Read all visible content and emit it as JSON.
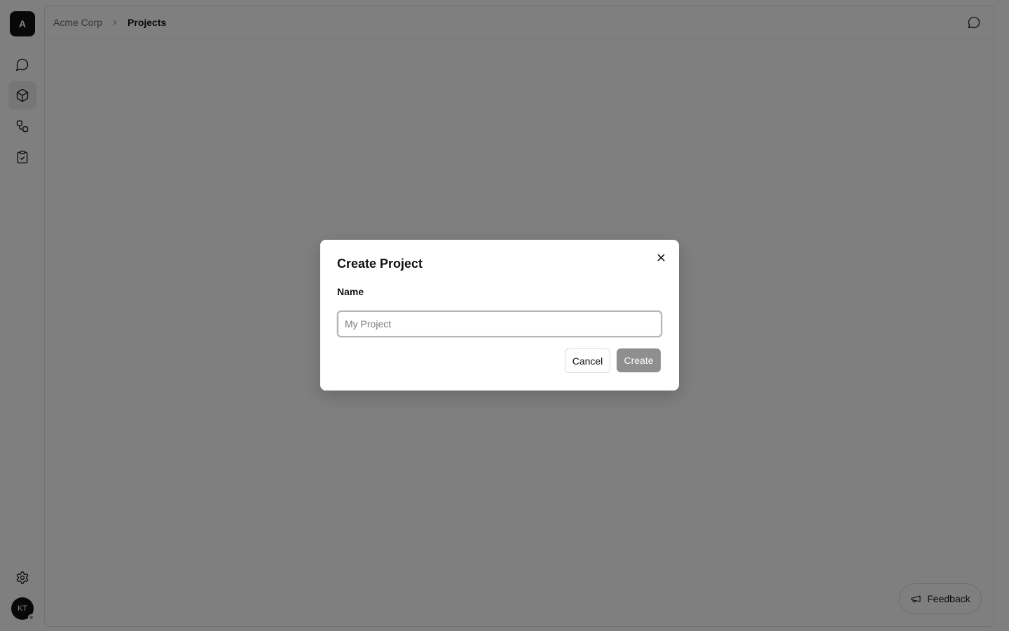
{
  "workspace": {
    "initial": "A"
  },
  "sidebar": {
    "items": [
      {
        "name": "chats",
        "icon": "message-circle-icon"
      },
      {
        "name": "projects",
        "icon": "box-icon",
        "active": true
      },
      {
        "name": "workflows",
        "icon": "workflow-icon"
      },
      {
        "name": "tasks",
        "icon": "clipboard-check-icon"
      }
    ],
    "settings_icon": "gear-icon",
    "user_initials": "KT"
  },
  "breadcrumb": {
    "parent": "Acme Corp",
    "current": "Projects"
  },
  "header": {
    "chat_icon": "chat-bubble-icon"
  },
  "feedback": {
    "label": "Feedback",
    "icon": "megaphone-icon"
  },
  "dialog": {
    "title": "Create Project",
    "name_label": "Name",
    "name_value": "",
    "name_placeholder": "My Project",
    "cancel_label": "Cancel",
    "create_label": "Create"
  },
  "colors": {
    "overlay": "rgba(0,0,0,0.5)",
    "create_button_disabled": "#8f8f8f",
    "logo_bg": "#111111"
  }
}
